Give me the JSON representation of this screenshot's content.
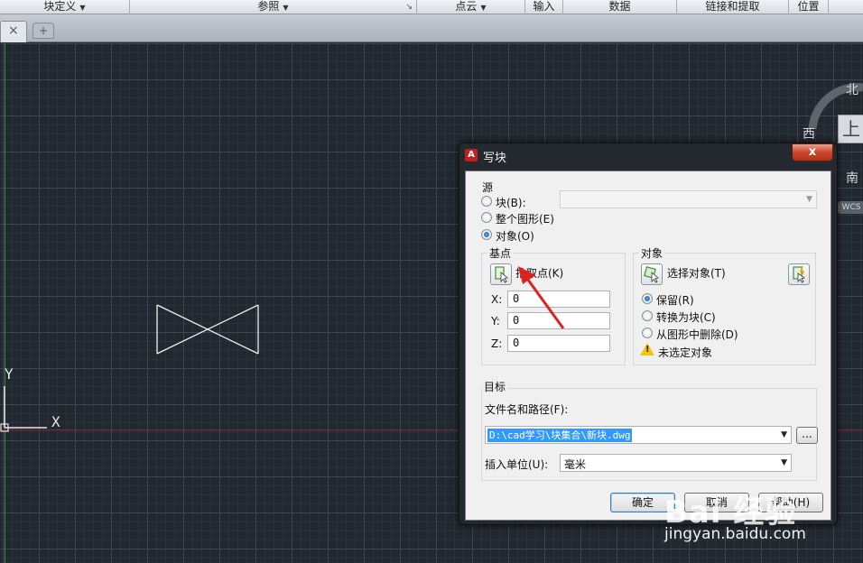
{
  "ribbon": {
    "panels": [
      {
        "label": "块定义",
        "caret": "▼"
      },
      {
        "label": "参照",
        "caret": "▼"
      },
      {
        "label": "点云",
        "caret": "▼"
      },
      {
        "label": "输入",
        "caret": ""
      },
      {
        "label": "数据",
        "caret": ""
      },
      {
        "label": "链接和提取",
        "caret": ""
      },
      {
        "label": "位置",
        "caret": ""
      }
    ]
  },
  "tabs": {
    "close_glyph": "×",
    "new_tab_glyph": "+"
  },
  "drawing": {
    "ucs_y": "Y",
    "ucs_x": "X"
  },
  "viewcube": {
    "north": "北",
    "west": "西",
    "south": "南",
    "face": "上",
    "wcs": "WCS"
  },
  "dialog": {
    "title": "写块",
    "logo": "A",
    "close": "x",
    "source": {
      "label": "源",
      "options": [
        {
          "label": "块(B):",
          "selected": false
        },
        {
          "label": "整个图形(E)",
          "selected": false
        },
        {
          "label": "对象(O)",
          "selected": true
        }
      ],
      "block_combo_value": ""
    },
    "base_point": {
      "label": "基点",
      "pick_label": "拾取点(K)",
      "x_label": "X:",
      "x_value": "0",
      "y_label": "Y:",
      "y_value": "0",
      "z_label": "Z:",
      "z_value": "0"
    },
    "objects": {
      "label": "对象",
      "select_label": "选择对象(T)",
      "options": [
        {
          "label": "保留(R)",
          "selected": true
        },
        {
          "label": "转换为块(C)",
          "selected": false
        },
        {
          "label": "从图形中删除(D)",
          "selected": false
        }
      ],
      "warning": "未选定对象"
    },
    "destination": {
      "label": "目标",
      "path_label": "文件名和路径(F):",
      "path_value": "D:\\cad学习\\块集合\\新块.dwg",
      "browse": "...",
      "units_label": "插入单位(U):",
      "units_value": "毫米"
    },
    "buttons": {
      "ok": "确定",
      "cancel": "取消",
      "help": "帮助(H)"
    }
  },
  "watermark": {
    "brand": "Bai 经验",
    "url": "jingyan.baidu.com"
  },
  "colors": {
    "canvas": "#212830",
    "arrow": "#e02020",
    "selection": "#3399ff"
  }
}
